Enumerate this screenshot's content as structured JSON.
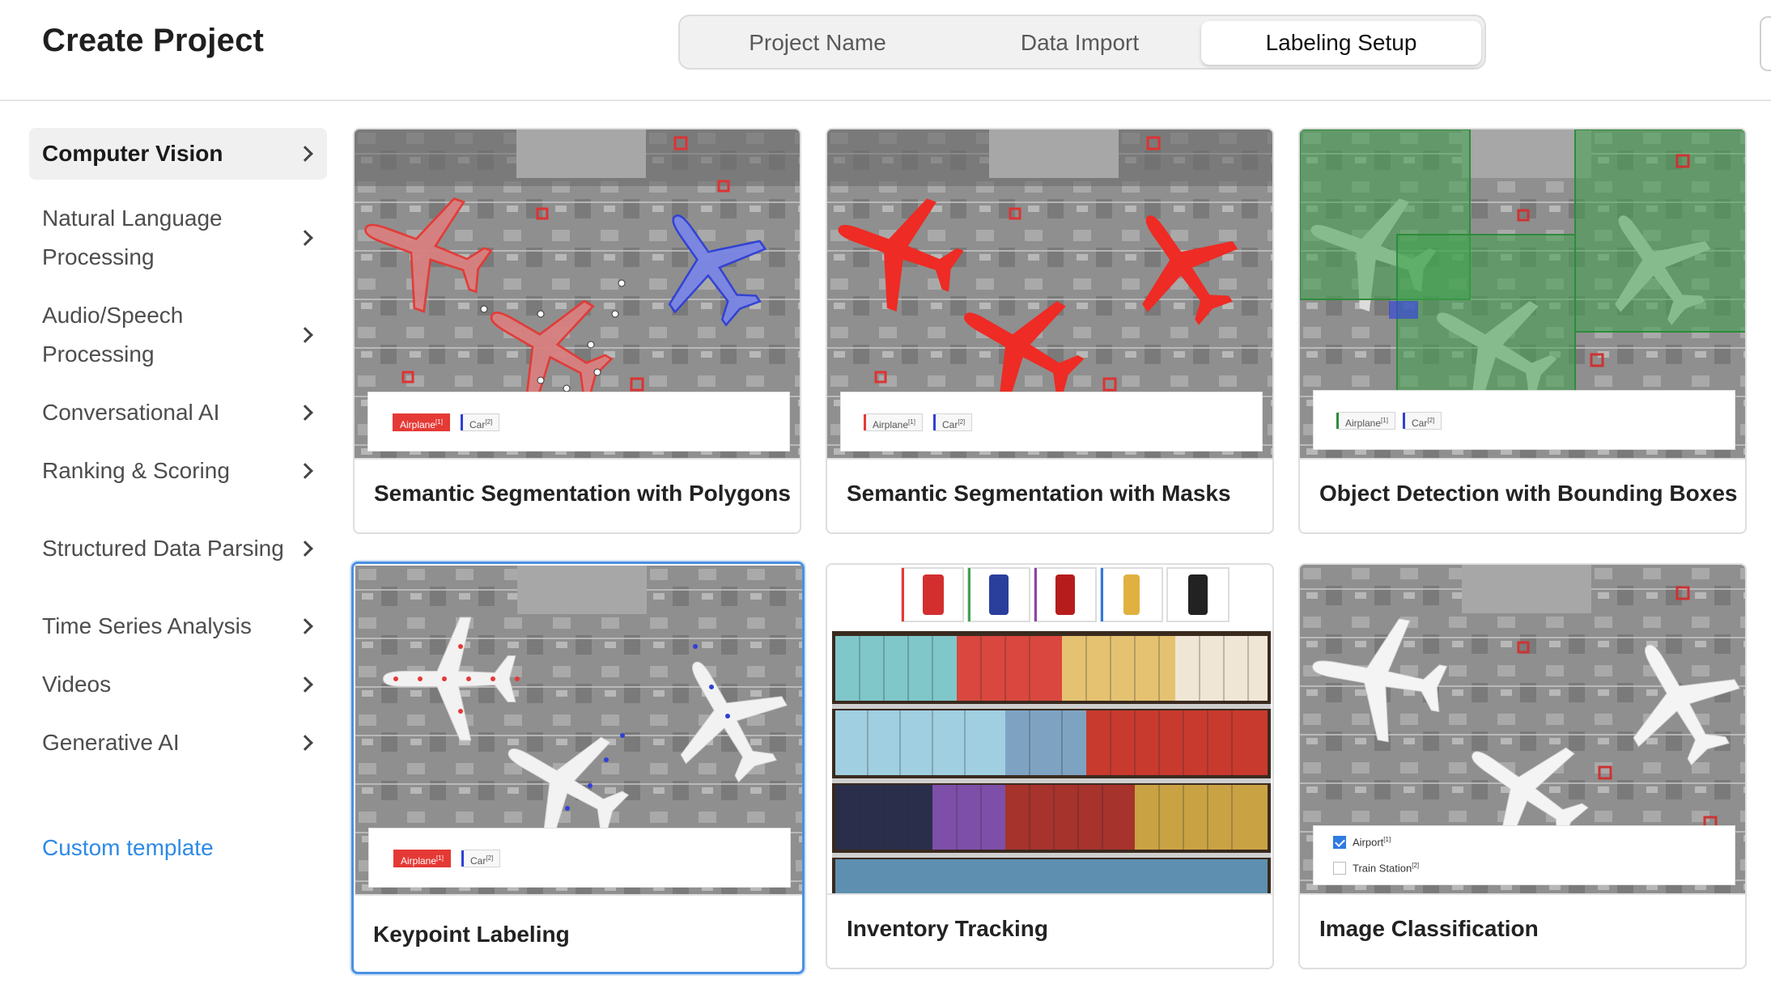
{
  "header": {
    "title": "Create Project",
    "steps": [
      {
        "label": "Project Name",
        "active": false
      },
      {
        "label": "Data Import",
        "active": false
      },
      {
        "label": "Labeling Setup",
        "active": true
      }
    ]
  },
  "sidebar": {
    "items": [
      {
        "label": "Computer Vision",
        "active": true
      },
      {
        "label": "Natural Language Processing",
        "active": false
      },
      {
        "label": "Audio/Speech Processing",
        "active": false
      },
      {
        "label": "Conversational AI",
        "active": false
      },
      {
        "label": "Ranking & Scoring",
        "active": false
      },
      {
        "label": "Structured Data Parsing",
        "active": false
      },
      {
        "label": "Time Series Analysis",
        "active": false
      },
      {
        "label": "Videos",
        "active": false
      },
      {
        "label": "Generative AI",
        "active": false
      }
    ],
    "custom_template": "Custom template"
  },
  "templates": [
    {
      "title": "Semantic Segmentation with Polygons",
      "labels": [
        {
          "text": "Airplane",
          "num": "[1]"
        },
        {
          "text": "Car",
          "num": "[2]"
        }
      ]
    },
    {
      "title": "Semantic Segmentation with Masks",
      "labels": [
        {
          "text": "Airplane",
          "num": "[1]"
        },
        {
          "text": "Car",
          "num": "[2]"
        }
      ]
    },
    {
      "title": "Object Detection with Bounding Boxes",
      "labels": [
        {
          "text": "Airplane",
          "num": "[1]"
        },
        {
          "text": "Car",
          "num": "[2]"
        }
      ]
    },
    {
      "title": "Keypoint Labeling",
      "selected": true,
      "labels": [
        {
          "text": "Airplane",
          "num": "[1]"
        },
        {
          "text": "Car",
          "num": "[2]"
        }
      ]
    },
    {
      "title": "Inventory Tracking",
      "labels": []
    },
    {
      "title": "Image Classification",
      "choices": [
        {
          "text": "Airport",
          "num": "[1]",
          "checked": true
        },
        {
          "text": "Train Station",
          "num": "[2]",
          "checked": false
        }
      ]
    }
  ],
  "icons": {
    "chevron": "chevron-right-icon",
    "checkbox": "checkbox-icon"
  },
  "colors": {
    "accent": "#4a90e2",
    "link": "#2f8ae6",
    "airplane": "#e53935",
    "car": "#2f3fd6",
    "mask_green": "#3fa34d"
  }
}
